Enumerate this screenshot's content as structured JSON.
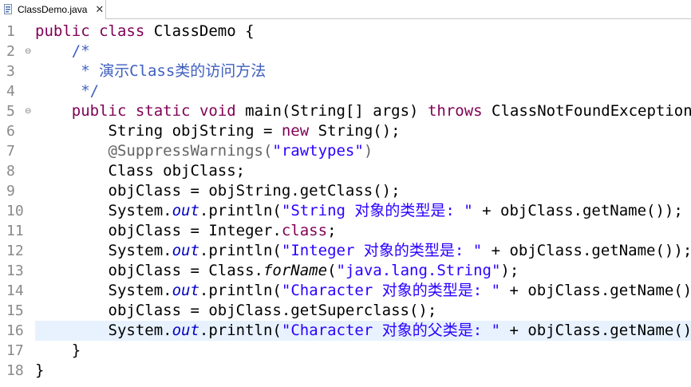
{
  "tab": {
    "label": "ClassDemo.java",
    "close": "✕",
    "icon": "java-file-icon"
  },
  "colors": {
    "keyword": "#7f0055",
    "comment": "#3f5fbf",
    "string": "#2a00ff",
    "field": "#0000c0",
    "annotation": "#646464",
    "line_number": "#8a8a8a",
    "current_line": "#e8f2fe"
  },
  "editor": {
    "current_line": 16,
    "lines": [
      {
        "n": "1",
        "fold": "",
        "tokens": [
          {
            "t": "public",
            "c": "kw"
          },
          {
            "t": " "
          },
          {
            "t": "class",
            "c": "kw"
          },
          {
            "t": " ClassDemo {"
          }
        ]
      },
      {
        "n": "2",
        "fold": "⊖",
        "tokens": [
          {
            "t": "    "
          },
          {
            "t": "/*",
            "c": "cm"
          }
        ]
      },
      {
        "n": "3",
        "fold": "",
        "tokens": [
          {
            "t": "     "
          },
          {
            "t": "* 演示Class类的访问方法",
            "c": "cm"
          }
        ]
      },
      {
        "n": "4",
        "fold": "",
        "tokens": [
          {
            "t": "     "
          },
          {
            "t": "*/",
            "c": "cm"
          }
        ]
      },
      {
        "n": "5",
        "fold": "⊖",
        "tokens": [
          {
            "t": "    "
          },
          {
            "t": "public",
            "c": "kw"
          },
          {
            "t": " "
          },
          {
            "t": "static",
            "c": "kw"
          },
          {
            "t": " "
          },
          {
            "t": "void",
            "c": "kw"
          },
          {
            "t": " main(String[] args) "
          },
          {
            "t": "throws",
            "c": "kw"
          },
          {
            "t": " ClassNotFoundException {"
          }
        ]
      },
      {
        "n": "6",
        "fold": "",
        "tokens": [
          {
            "t": "        String objString = "
          },
          {
            "t": "new",
            "c": "kw"
          },
          {
            "t": " String();"
          }
        ]
      },
      {
        "n": "7",
        "fold": "",
        "tokens": [
          {
            "t": "        "
          },
          {
            "t": "@SuppressWarnings(",
            "c": "an"
          },
          {
            "t": "\"rawtypes\"",
            "c": "st"
          },
          {
            "t": ")",
            "c": "an"
          }
        ]
      },
      {
        "n": "8",
        "fold": "",
        "tokens": [
          {
            "t": "        Class objClass;"
          }
        ]
      },
      {
        "n": "9",
        "fold": "",
        "tokens": [
          {
            "t": "        objClass = objString.getClass();"
          }
        ]
      },
      {
        "n": "10",
        "fold": "",
        "tokens": [
          {
            "t": "        System."
          },
          {
            "t": "out",
            "c": "fd"
          },
          {
            "t": ".println("
          },
          {
            "t": "\"String 对象的类型是: \"",
            "c": "st"
          },
          {
            "t": " + objClass.getName());"
          }
        ]
      },
      {
        "n": "11",
        "fold": "",
        "tokens": [
          {
            "t": "        objClass = Integer."
          },
          {
            "t": "class",
            "c": "kw"
          },
          {
            "t": ";"
          }
        ]
      },
      {
        "n": "12",
        "fold": "",
        "tokens": [
          {
            "t": "        System."
          },
          {
            "t": "out",
            "c": "fd"
          },
          {
            "t": ".println("
          },
          {
            "t": "\"Integer 对象的类型是: \"",
            "c": "st"
          },
          {
            "t": " + objClass.getName());"
          }
        ]
      },
      {
        "n": "13",
        "fold": "",
        "tokens": [
          {
            "t": "        objClass = Class."
          },
          {
            "t": "forName",
            "c": "it"
          },
          {
            "t": "("
          },
          {
            "t": "\"java.lang.String\"",
            "c": "st"
          },
          {
            "t": ");"
          }
        ]
      },
      {
        "n": "14",
        "fold": "",
        "tokens": [
          {
            "t": "        System."
          },
          {
            "t": "out",
            "c": "fd"
          },
          {
            "t": ".println("
          },
          {
            "t": "\"Character 对象的类型是: \"",
            "c": "st"
          },
          {
            "t": " + objClass.getName());"
          }
        ]
      },
      {
        "n": "15",
        "fold": "",
        "tokens": [
          {
            "t": "        objClass = objClass.getSuperclass();"
          }
        ]
      },
      {
        "n": "16",
        "fold": "",
        "tokens": [
          {
            "t": "        System."
          },
          {
            "t": "out",
            "c": "fd"
          },
          {
            "t": ".println("
          },
          {
            "t": "\"Character 对象的父类是: \"",
            "c": "st"
          },
          {
            "t": " + objClass.getName());"
          }
        ]
      },
      {
        "n": "17",
        "fold": "",
        "tokens": [
          {
            "t": "    }"
          }
        ]
      },
      {
        "n": "18",
        "fold": "",
        "tokens": [
          {
            "t": "}"
          }
        ]
      }
    ]
  }
}
